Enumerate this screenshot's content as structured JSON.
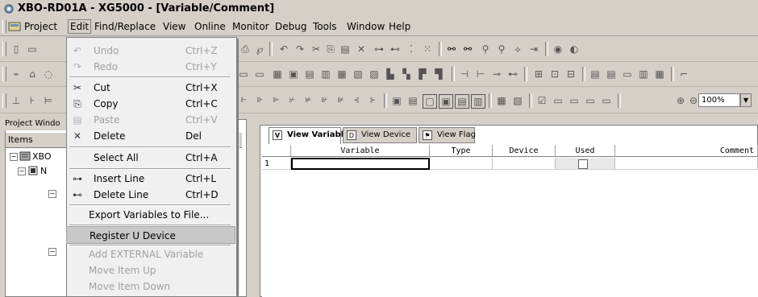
{
  "window": {
    "title": "XBO-RD01A - XG5000 - [Variable/Comment]"
  },
  "menubar": {
    "items": [
      {
        "label": "Project",
        "key": "P"
      },
      {
        "label": "Edit",
        "key": "E"
      },
      {
        "label": "Find/Replace",
        "key": "F"
      },
      {
        "label": "View",
        "key": "V"
      },
      {
        "label": "Online",
        "key": "O"
      },
      {
        "label": "Monitor",
        "key": "M"
      },
      {
        "label": "Debug",
        "key": "D"
      },
      {
        "label": "Tools",
        "key": "T"
      },
      {
        "label": "Window",
        "key": "W"
      },
      {
        "label": "Help",
        "key": "H"
      }
    ]
  },
  "toolbar": {
    "zoom_value": "100%"
  },
  "project_panel": {
    "header": "Project Windo",
    "items_label": "Items",
    "tree_root": "XBO",
    "tree_child": "N"
  },
  "editor": {
    "tabs": [
      {
        "label": "View Variable",
        "icon": "variable-icon"
      },
      {
        "label": "View Device",
        "icon": "device-icon"
      },
      {
        "label": "View Flag",
        "icon": "flag-icon"
      }
    ],
    "columns": [
      "Variable",
      "Type",
      "Device",
      "Used",
      "Comment"
    ],
    "rows": [
      {
        "num": "1",
        "variable": "",
        "type": "",
        "device": "",
        "used": false,
        "comment": ""
      }
    ]
  },
  "edit_menu": {
    "items": [
      {
        "label": "Undo",
        "accel": "Ctrl+Z",
        "icon": "undo-icon",
        "enabled": false
      },
      {
        "label": "Redo",
        "accel": "Ctrl+Y",
        "icon": "redo-icon",
        "enabled": false
      },
      {
        "label": "Cut",
        "accel": "Ctrl+X",
        "icon": "cut-icon",
        "enabled": true
      },
      {
        "label": "Copy",
        "accel": "Ctrl+C",
        "icon": "copy-icon",
        "enabled": true
      },
      {
        "label": "Paste",
        "accel": "Ctrl+V",
        "icon": "paste-icon",
        "enabled": false
      },
      {
        "label": "Delete",
        "accel": "Del",
        "icon": "delete-icon",
        "enabled": true
      },
      {
        "label": "Select All",
        "accel": "Ctrl+A",
        "icon": "",
        "enabled": true
      },
      {
        "label": "Insert Line",
        "accel": "Ctrl+L",
        "icon": "insert-line-icon",
        "enabled": true
      },
      {
        "label": "Delete Line",
        "accel": "Ctrl+D",
        "icon": "delete-line-icon",
        "enabled": true
      },
      {
        "label": "Export Variables to File...",
        "accel": "",
        "icon": "",
        "enabled": true
      },
      {
        "label": "Register U Device",
        "accel": "",
        "icon": "",
        "enabled": true,
        "selected": true
      },
      {
        "label": "Add EXTERNAL Variable",
        "accel": "",
        "icon": "",
        "enabled": false
      },
      {
        "label": "Move Item Up",
        "accel": "",
        "icon": "",
        "enabled": false
      },
      {
        "label": "Move Item Down",
        "accel": "",
        "icon": "",
        "enabled": false
      }
    ]
  },
  "colors": {
    "chrome": "#d4d0c8",
    "menu_bg": "#f0f0f0",
    "selected": "#c8c8c8",
    "disabled": "#a0a0a0"
  }
}
